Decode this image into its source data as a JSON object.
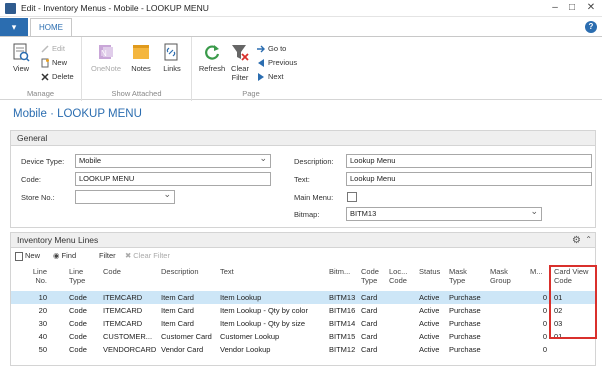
{
  "window": {
    "title": "Edit - Inventory Menus - Mobile - LOOKUP MENU",
    "minimize": "–",
    "restore": "□",
    "close": "✕"
  },
  "ribbon": {
    "file_label": "▾",
    "home_tab": "HOME",
    "help_label": "?",
    "manage": {
      "label": "Manage",
      "view": "View",
      "edit": "Edit",
      "new": "New",
      "delete": "Delete"
    },
    "show_attached": {
      "label": "Show Attached",
      "onenote": "OneNote",
      "notes": "Notes",
      "links": "Links"
    },
    "page": {
      "label": "Page",
      "refresh": "Refresh",
      "clear_filter_1": "Clear",
      "clear_filter_2": "Filter",
      "goto": "Go to",
      "previous": "Previous",
      "next": "Next"
    }
  },
  "page_title": "Mobile · LOOKUP MENU",
  "general": {
    "header": "General",
    "device_type_label": "Device Type:",
    "device_type_value": "Mobile",
    "code_label": "Code:",
    "code_value": "LOOKUP MENU",
    "store_no_label": "Store No.:",
    "store_no_value": "",
    "description_label": "Description:",
    "description_value": "Lookup Menu",
    "text_label": "Text:",
    "text_value": "Lookup Menu",
    "main_menu_label": "Main Menu:",
    "main_menu_checked": false,
    "bitmap_label": "Bitmap:",
    "bitmap_value": "BITM13"
  },
  "lines": {
    "header": "Inventory Menu Lines",
    "new": "New",
    "find": "Find",
    "filter": "Filter",
    "clear_filter": "Clear Filter",
    "columns": {
      "line_no_1": "Line",
      "line_no_2": "No.",
      "line_type_1": "Line",
      "line_type_2": "Type",
      "code": "Code",
      "description": "Description",
      "text": "Text",
      "bitmap": "Bitm...",
      "code_type_1": "Code",
      "code_type_2": "Type",
      "lookup_code_1": "Loc...",
      "lookup_code_2": "Code",
      "status": "Status",
      "mask_type_1": "Mask",
      "mask_type_2": "Type",
      "mask_group_1": "Mask",
      "mask_group_2": "Group",
      "m": "M...",
      "card_view_1": "Card View",
      "card_view_2": "Code"
    },
    "rows": [
      {
        "line_no": "10",
        "line_type": "Code",
        "code": "ITEMCARD",
        "description": "Item Card",
        "text": "Item Lookup",
        "bitmap": "BITM13",
        "code_type": "Card",
        "lookup_code": "",
        "status": "Active",
        "mask_type": "Purchase",
        "mask_group": "",
        "m": "0",
        "card_view": "01"
      },
      {
        "line_no": "20",
        "line_type": "Code",
        "code": "ITEMCARD",
        "description": "Item Card",
        "text": "Item Lookup - Qty by color",
        "bitmap": "BITM16",
        "code_type": "Card",
        "lookup_code": "",
        "status": "Active",
        "mask_type": "Purchase",
        "mask_group": "",
        "m": "0",
        "card_view": "02"
      },
      {
        "line_no": "30",
        "line_type": "Code",
        "code": "ITEMCARD",
        "description": "Item Card",
        "text": "Item Lookup - Qty by size",
        "bitmap": "BITM14",
        "code_type": "Card",
        "lookup_code": "",
        "status": "Active",
        "mask_type": "Purchase",
        "mask_group": "",
        "m": "0",
        "card_view": "03"
      },
      {
        "line_no": "40",
        "line_type": "Code",
        "code": "CUSTOMER...",
        "description": "Customer Card",
        "text": "Customer Lookup",
        "bitmap": "BITM15",
        "code_type": "Card",
        "lookup_code": "",
        "status": "Active",
        "mask_type": "Purchase",
        "mask_group": "",
        "m": "0",
        "card_view": "01"
      },
      {
        "line_no": "50",
        "line_type": "Code",
        "code": "VENDORCARD",
        "description": "Vendor Card",
        "text": "Vendor Lookup",
        "bitmap": "BITM12",
        "code_type": "Card",
        "lookup_code": "",
        "status": "Active",
        "mask_type": "Purchase",
        "mask_group": "",
        "m": "0",
        "card_view": ""
      }
    ]
  },
  "colors": {
    "accent": "#2b6db0",
    "selected_row": "#cde6f7",
    "highlight_box": "#d9302c"
  }
}
